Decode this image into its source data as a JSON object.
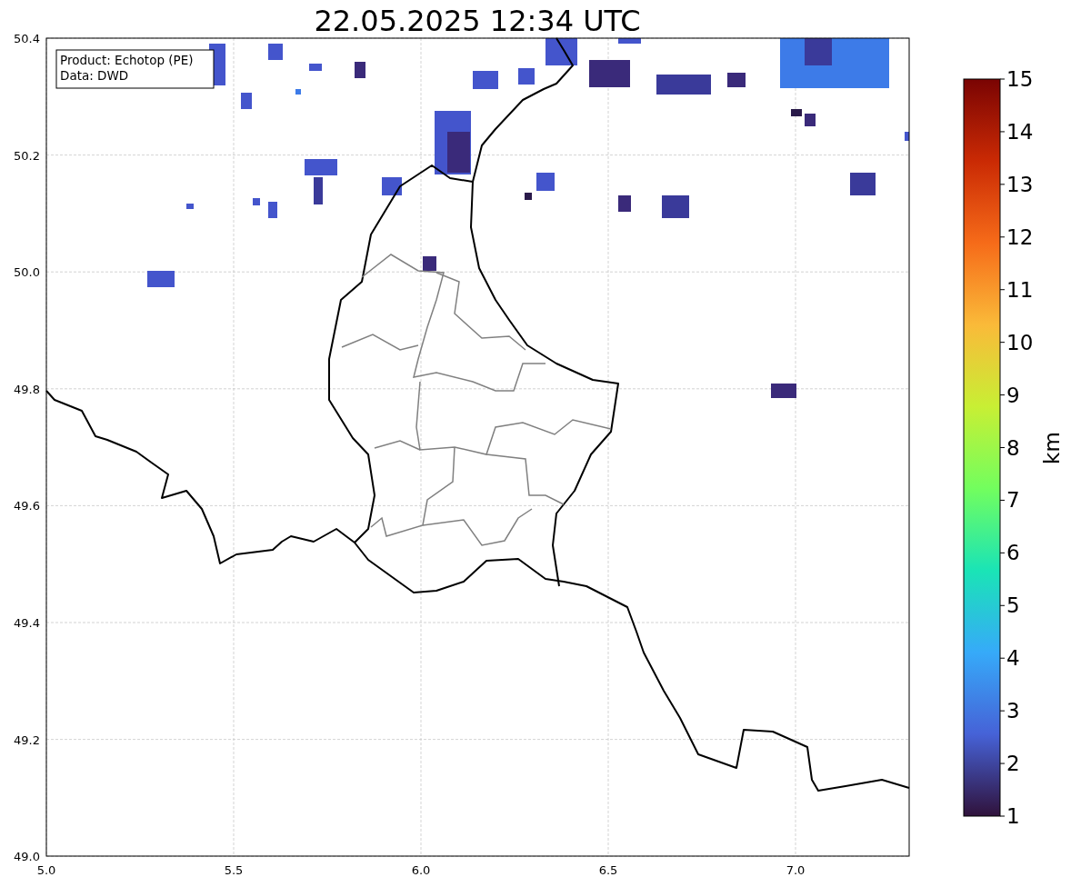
{
  "title": "22.05.2025 12:34 UTC",
  "legend": [
    "Product: Echotop (PE)",
    "Data: DWD"
  ],
  "x_ticks": [
    "5.0",
    "5.5",
    "6.0",
    "6.5",
    "7.0"
  ],
  "y_ticks": [
    "50.4",
    "50.2",
    "50.0",
    "49.8",
    "49.6",
    "49.4",
    "49.2",
    "49.0"
  ],
  "colorbar": {
    "label": "km",
    "ticks": [
      "15",
      "14",
      "13",
      "12",
      "11",
      "10",
      "9",
      "8",
      "7",
      "6",
      "5",
      "4",
      "3",
      "2",
      "1"
    ]
  }
}
